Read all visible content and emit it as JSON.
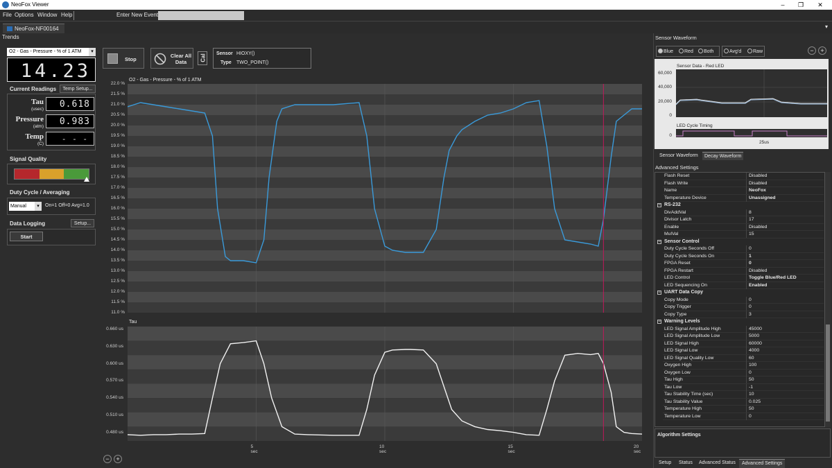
{
  "window": {
    "title": "NeoFox Viewer"
  },
  "menu": {
    "items": [
      "File",
      "Options",
      "Window",
      "Help"
    ],
    "new_event_label": "Enter New Event:",
    "new_event_value": ""
  },
  "doc_tab": "NeoFox-NF00164",
  "trends_label": "Trends",
  "left": {
    "channel_select": "O2 - Gas - Pressure - % of 1 ATM",
    "main_reading": "14.23",
    "current_readings": "Current Readings",
    "temp_setup": "Temp Setup...",
    "tau_label": "Tau",
    "tau_unit": "(usec)",
    "tau_value": "0.618",
    "pressure_label": "Pressure",
    "pressure_unit": "(atm)",
    "pressure_value": "0.983",
    "temp_label": "Temp",
    "temp_unit": "(C)",
    "temp_value": "- - -",
    "signal_quality": "Signal Quality",
    "duty_cycle": "Duty Cycle / Averaging",
    "duty_mode": "Manual",
    "duty_desc": "On=1 Off=0 Avg=1.0",
    "data_logging": "Data Logging",
    "setup": "Setup...",
    "start": "Start"
  },
  "toolbar": {
    "stop": "Stop",
    "clear_all": "Clear All",
    "clear_data": "Data",
    "cal": "Cal",
    "sensor_label": "Sensor",
    "sensor_value": "HIOXY()",
    "type_label": "Type",
    "type_value": "TWO_POINT()"
  },
  "chart_data": [
    {
      "type": "line",
      "title": "O2 - Gas - Pressure - % of 1 ATM",
      "ylim": [
        11.0,
        22.0
      ],
      "yticks": [
        "22.0 %",
        "21.5 %",
        "21.0 %",
        "20.5 %",
        "20.0 %",
        "19.5 %",
        "19.0 %",
        "18.5 %",
        "18.0 %",
        "17.5 %",
        "17.0 %",
        "16.5 %",
        "16.0 %",
        "15.5 %",
        "15.0 %",
        "14.5 %",
        "14.0 %",
        "13.5 %",
        "13.0 %",
        "12.5 %",
        "12.0 %",
        "11.5 %",
        "11.0 %"
      ],
      "xlim": [
        0,
        20
      ],
      "color": "#3a9ad9",
      "cursor_x": 18.5,
      "x": [
        0,
        0.5,
        1,
        1.5,
        2,
        2.5,
        3,
        3.3,
        3.5,
        3.8,
        4,
        4.5,
        5,
        5.3,
        5.5,
        5.8,
        6,
        6.5,
        7,
        8,
        9,
        9.3,
        9.6,
        10,
        10.3,
        10.8,
        11,
        11.5,
        12,
        12.3,
        12.5,
        12.8,
        13,
        13.5,
        14,
        14.5,
        15,
        15.5,
        16,
        16.3,
        16.6,
        17,
        17.5,
        18,
        18.3,
        18.5,
        18.8,
        19,
        19.3,
        19.6,
        20
      ],
      "values": [
        20.9,
        21.1,
        21.0,
        20.9,
        20.8,
        20.7,
        20.6,
        19.5,
        16.0,
        13.7,
        13.5,
        13.5,
        13.4,
        14.5,
        17.5,
        20.2,
        20.8,
        21.0,
        21.0,
        21.0,
        21.1,
        19.5,
        16.0,
        14.2,
        14.0,
        13.9,
        13.9,
        13.9,
        15.0,
        17.5,
        18.8,
        19.5,
        19.8,
        20.2,
        20.5,
        20.6,
        20.8,
        21.1,
        21.2,
        19.0,
        16.0,
        14.5,
        14.4,
        14.3,
        14.2,
        15.5,
        18.5,
        20.2,
        20.5,
        20.8,
        20.8
      ]
    },
    {
      "type": "line",
      "title": "Tau",
      "ylim": [
        0.465,
        0.665
      ],
      "yticks": [
        "0.660 us",
        "0.630 us",
        "0.600 us",
        "0.570 us",
        "0.540 us",
        "0.510 us",
        "0.480 us"
      ],
      "xlim": [
        0,
        20
      ],
      "xticks": [
        "5 sec",
        "10 sec",
        "15 sec",
        "20 sec"
      ],
      "color": "#f2f2f2",
      "cursor_x": 18.5,
      "x": [
        0,
        0.5,
        1,
        1.5,
        2,
        2.5,
        3,
        3.3,
        3.6,
        4,
        4.5,
        5,
        5.3,
        5.6,
        6,
        6.5,
        7,
        8,
        9,
        9.3,
        9.6,
        10,
        10.3,
        10.8,
        11,
        11.5,
        12,
        12.3,
        12.6,
        13,
        13.5,
        14,
        14.5,
        15,
        15.5,
        16,
        16.3,
        16.6,
        17,
        17.5,
        18,
        18.3,
        18.5,
        18.8,
        19,
        19.3,
        19.6,
        20
      ],
      "values": [
        0.476,
        0.475,
        0.476,
        0.476,
        0.477,
        0.477,
        0.478,
        0.54,
        0.6,
        0.635,
        0.637,
        0.64,
        0.6,
        0.54,
        0.49,
        0.477,
        0.476,
        0.475,
        0.475,
        0.52,
        0.58,
        0.62,
        0.624,
        0.625,
        0.625,
        0.624,
        0.6,
        0.56,
        0.52,
        0.5,
        0.49,
        0.485,
        0.483,
        0.48,
        0.476,
        0.475,
        0.52,
        0.57,
        0.615,
        0.618,
        0.616,
        0.618,
        0.6,
        0.55,
        0.49,
        0.48,
        0.478,
        0.477
      ]
    },
    {
      "type": "line",
      "title": "Sensor Data - Red LED",
      "yticks": [
        "60,000",
        "40,000",
        "20,000",
        "0"
      ],
      "ylim": [
        0,
        60000
      ]
    },
    {
      "type": "line",
      "title": "LED Cycle Timing",
      "yticks": [
        "0"
      ],
      "xticks": [
        "25us"
      ]
    }
  ],
  "right": {
    "sensor_waveform": "Sensor Waveform",
    "radios": [
      "Blue",
      "Red",
      "Both",
      "Avg'd",
      "Raw"
    ],
    "wave_tabs": [
      "Sensor Waveform",
      "Decay Waveform"
    ],
    "advanced_settings": "Advanced Settings",
    "rows": [
      {
        "k": "Flash Reset",
        "v": "Disabled"
      },
      {
        "k": "Flash Write",
        "v": "Disabled"
      },
      {
        "k": "Name",
        "v": "NeoFox",
        "b": true
      },
      {
        "k": "Temperature Device",
        "v": "Unassigned",
        "b": true
      },
      {
        "cat": "RS-232"
      },
      {
        "k": "DivAddVal",
        "v": "8"
      },
      {
        "k": "Divisor Latch",
        "v": "17"
      },
      {
        "k": "Enable",
        "v": "Disabled"
      },
      {
        "k": "MulVal",
        "v": "15"
      },
      {
        "cat": "Sensor Control"
      },
      {
        "k": "Duty Cycle Seconds Off",
        "v": "0"
      },
      {
        "k": "Duty Cycle Seconds On",
        "v": "1",
        "b": true
      },
      {
        "k": "FPGA Reset",
        "v": "0",
        "b": true
      },
      {
        "k": "FPGA Restart",
        "v": "Disabled"
      },
      {
        "k": "LED Control",
        "v": "Toggle Blue/Red LED",
        "b": true
      },
      {
        "k": "LED Sequencing On",
        "v": "Enabled",
        "b": true
      },
      {
        "cat": "UART Data Copy"
      },
      {
        "k": "Copy Mode",
        "v": "0"
      },
      {
        "k": "Copy Trigger",
        "v": "0"
      },
      {
        "k": "Copy Type",
        "v": "3"
      },
      {
        "cat": "Warning Levels"
      },
      {
        "k": "LED Signal Amplitude High",
        "v": "45000"
      },
      {
        "k": "LED Signal Amplitude Low",
        "v": "5000"
      },
      {
        "k": "LED Signal High",
        "v": "60000"
      },
      {
        "k": "LED Signal Low",
        "v": "4000"
      },
      {
        "k": "LED Signal Quality Low",
        "v": "60"
      },
      {
        "k": "Oxygen High",
        "v": "100"
      },
      {
        "k": "Oxygen Low",
        "v": "0"
      },
      {
        "k": "Tau High",
        "v": "50"
      },
      {
        "k": "Tau Low",
        "v": "-1"
      },
      {
        "k": "Tau Stability Time (sec)",
        "v": "10"
      },
      {
        "k": "Tau Stability Value",
        "v": "0.025"
      },
      {
        "k": "Temperature High",
        "v": "50"
      },
      {
        "k": "Temperature Low",
        "v": "0"
      }
    ],
    "algorithm_settings": "Algorithm Settings",
    "bottom_tabs": [
      "Setup",
      "Status",
      "Advanced Status",
      "Advanced Settings"
    ]
  }
}
